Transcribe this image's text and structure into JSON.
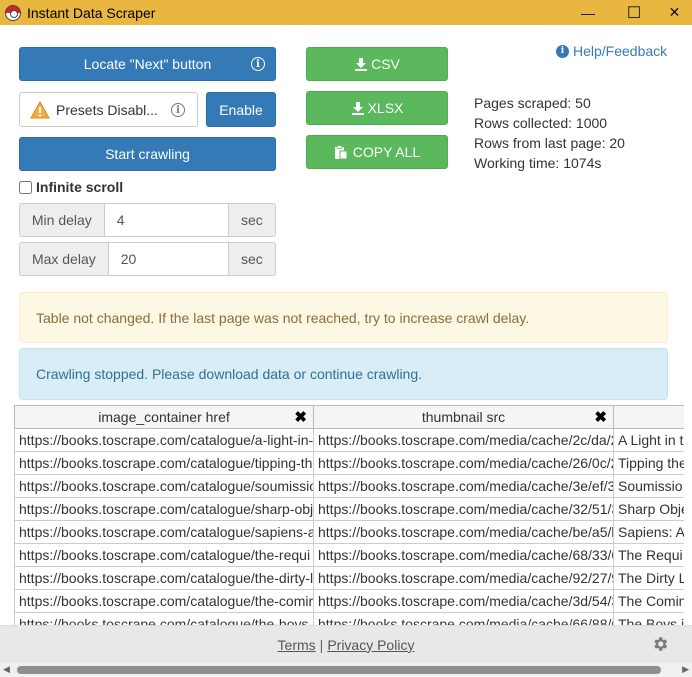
{
  "window": {
    "title": "Instant Data Scraper",
    "minimize_glyph": "—",
    "maximize_glyph": "☐",
    "close_glyph": "✕"
  },
  "controls": {
    "locate_next_label": "Locate \"Next\" button",
    "presets_label": "Presets Disabl...",
    "enable_label": "Enable",
    "start_crawling_label": "Start crawling",
    "infinite_scroll_label": "Infinite scroll",
    "infinite_scroll_checked": false,
    "min_delay_label": "Min delay",
    "min_delay_value": "4",
    "max_delay_label": "Max delay",
    "max_delay_value": "20",
    "unit_label": "sec"
  },
  "export": {
    "csv_label": "CSV",
    "xlsx_label": "XLSX",
    "copy_all_label": "COPY ALL"
  },
  "help_label": "Help/Feedback",
  "stats": {
    "pages_scraped": "Pages scraped: 50",
    "rows_collected": "Rows collected: 1000",
    "rows_last_page": "Rows from last page: 20",
    "working_time": "Working time: 1074s"
  },
  "alerts": {
    "warning": "Table not changed. If the last page was not reached, try to increase crawl delay.",
    "info": "Crawling stopped. Please download data or continue crawling."
  },
  "table": {
    "columns": [
      "image_container href",
      "thumbnail src",
      ""
    ],
    "rows": [
      [
        "https://books.toscrape.com/catalogue/a-light-in-",
        "https://books.toscrape.com/media/cache/2c/da/2",
        "A Light in t"
      ],
      [
        "https://books.toscrape.com/catalogue/tipping-th",
        "https://books.toscrape.com/media/cache/26/0c/2",
        "Tipping the"
      ],
      [
        "https://books.toscrape.com/catalogue/soumissio",
        "https://books.toscrape.com/media/cache/3e/ef/3",
        "Soumissio"
      ],
      [
        "https://books.toscrape.com/catalogue/sharp-obj",
        "https://books.toscrape.com/media/cache/32/51/3",
        "Sharp Obje"
      ],
      [
        "https://books.toscrape.com/catalogue/sapiens-a",
        "https://books.toscrape.com/media/cache/be/a5/b",
        "Sapiens: A"
      ],
      [
        "https://books.toscrape.com/catalogue/the-requi",
        "https://books.toscrape.com/media/cache/68/33/6",
        "The Requi"
      ],
      [
        "https://books.toscrape.com/catalogue/the-dirty-l",
        "https://books.toscrape.com/media/cache/92/27/9",
        "The Dirty L"
      ],
      [
        "https://books.toscrape.com/catalogue/the-comir",
        "https://books.toscrape.com/media/cache/3d/54/3",
        "The Comin"
      ],
      [
        "https://books.toscrape.com/catalogue/the-boys-",
        "https://books.toscrape.com/media/cache/66/88/6",
        "The Boys i"
      ]
    ]
  },
  "footer": {
    "terms_label": "Terms",
    "separator": "|",
    "privacy_label": "Privacy Policy"
  },
  "colors": {
    "titlebar": "#e9b640",
    "primary": "#337ab7",
    "success": "#5cb85c"
  }
}
